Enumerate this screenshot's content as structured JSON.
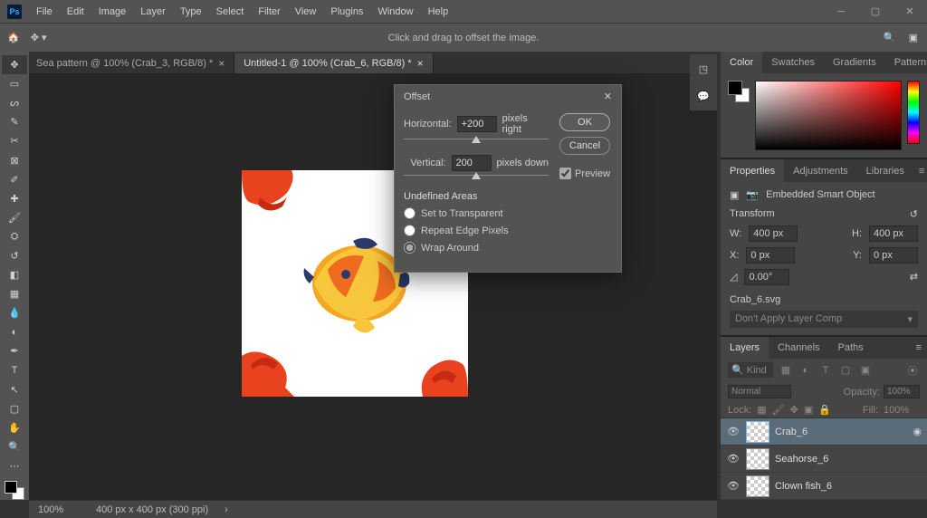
{
  "menubar": {
    "items": [
      "File",
      "Edit",
      "Image",
      "Layer",
      "Type",
      "Select",
      "Filter",
      "View",
      "Plugins",
      "Window",
      "Help"
    ]
  },
  "optionsbar": {
    "hint": "Click and drag to offset the image."
  },
  "tabs": [
    {
      "label": "Sea pattern @ 100% (Crab_3, RGB/8) *",
      "active": false
    },
    {
      "label": "Untitled-1 @ 100% (Crab_6, RGB/8) *",
      "active": true
    }
  ],
  "dialog": {
    "title": "Offset",
    "horizontal_label": "Horizontal:",
    "horizontal_value": "+200",
    "horizontal_unit": "pixels right",
    "vertical_label": "Vertical:",
    "vertical_value": "200",
    "vertical_unit": "pixels down",
    "undefined_areas_label": "Undefined Areas",
    "options": {
      "transparent": "Set to Transparent",
      "edge": "Repeat Edge Pixels",
      "wrap": "Wrap Around"
    },
    "selected": "wrap",
    "ok": "OK",
    "cancel": "Cancel",
    "preview_label": "Preview",
    "preview_checked": true
  },
  "panels": {
    "color_tabs": [
      "Color",
      "Swatches",
      "Gradients",
      "Patterns"
    ],
    "props_tabs": [
      "Properties",
      "Adjustments",
      "Libraries"
    ],
    "layer_tabs": [
      "Layers",
      "Channels",
      "Paths"
    ]
  },
  "properties": {
    "type_label": "Embedded Smart Object",
    "transform_label": "Transform",
    "w_label": "W:",
    "w_val": "400 px",
    "h_label": "H:",
    "h_val": "400 px",
    "x_label": "X:",
    "x_val": "0 px",
    "y_label": "Y:",
    "y_val": "0 px",
    "angle": "0.00°",
    "filename": "Crab_6.svg",
    "layer_comp": "Don't Apply Layer Comp"
  },
  "layers": {
    "filter_label": "Kind",
    "blend": "Normal",
    "opacity_label": "Opacity:",
    "opacity_val": "100%",
    "lock_label": "Lock:",
    "fill_label": "Fill:",
    "fill_val": "100%",
    "items": [
      {
        "name": "Crab_6",
        "selected": true,
        "smart": true
      },
      {
        "name": "Seahorse_6",
        "selected": false,
        "smart": false
      },
      {
        "name": "Clown fish_6",
        "selected": false,
        "smart": false
      }
    ]
  },
  "statusbar": {
    "zoom": "100%",
    "docinfo": "400 px x 400 px (300 ppi)"
  }
}
